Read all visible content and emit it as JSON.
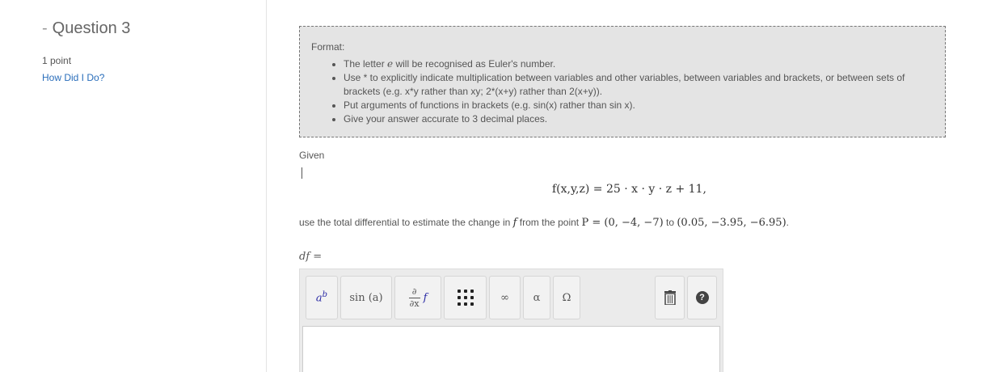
{
  "sidebar": {
    "dash": "-",
    "question_title": "Question 3",
    "points": "1 point",
    "how_did_i_do": "How Did I Do?"
  },
  "format": {
    "heading": "Format:",
    "items": [
      "The letter e will be recognised as Euler's number.",
      "Use * to explicitly indicate multiplication between variables and other variables, between variables and brackets, or between sets of brackets (e.g. x*y rather than xy; 2*(x+y) rather than 2(x+y)).",
      "Put arguments of functions in brackets (e.g. sin(x) rather than sin x).",
      "Give your answer accurate to 3 decimal places."
    ],
    "item0_before": "The letter ",
    "item0_e": "e",
    "item0_after": " will be recognised as Euler's number."
  },
  "question": {
    "given": "Given",
    "equation": "f(x,y,z) = 25 · x · y · z + 11,",
    "instruction_before": "use the total differential to estimate the change in ",
    "instruction_f": "f",
    "instruction_mid": " from the point ",
    "point_P": "P = (0, −4, −7)",
    "instruction_to": " to ",
    "point_Q": "(0.05, −3.95, −6.95)",
    "instruction_end": ".",
    "answer_label": "df ="
  },
  "toolbar": {
    "power": "a^b",
    "sin": "sin (a)",
    "partial_num": "∂",
    "partial_den": "∂x",
    "partial_f": "f",
    "infinity": "∞",
    "alpha": "α",
    "omega": "Ω",
    "trash_icon": "trash-icon",
    "help": "?"
  }
}
